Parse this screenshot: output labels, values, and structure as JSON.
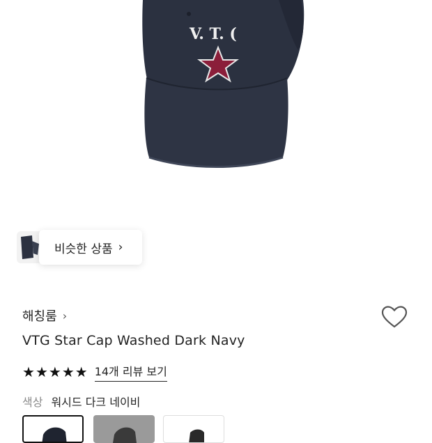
{
  "hero": {
    "cap_text": "V. T. (",
    "cap_color": "#2b3140",
    "star_color": "#8b1e3a"
  },
  "similar": {
    "label": "비슷한 상품",
    "chevron": "chevron-right-icon"
  },
  "product": {
    "brand": "해칭룸",
    "brand_chevron": "chevron-right-icon",
    "title": "VTG Star Cap Washed Dark Navy",
    "rating_stars": 5,
    "reviews_label": "14개 리뷰 보기",
    "wishlist_icon": "heart-outline-icon"
  },
  "color": {
    "label": "색상",
    "value": "워시드 다크 네이비"
  },
  "swatches": {
    "selected_index": 0
  }
}
